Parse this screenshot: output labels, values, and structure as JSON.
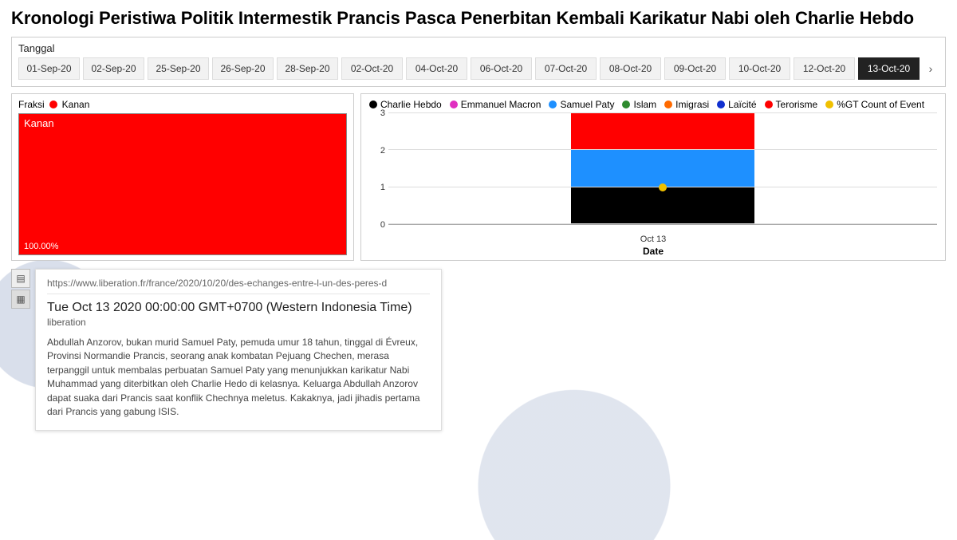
{
  "title": "Kronologi Peristiwa Politik Intermestik Prancis Pasca Penerbitan Kembali Karikatur Nabi oleh Charlie Hebdo",
  "slicer": {
    "label": "Tanggal",
    "dates": [
      "01-Sep-20",
      "02-Sep-20",
      "25-Sep-20",
      "26-Sep-20",
      "28-Sep-20",
      "02-Oct-20",
      "04-Oct-20",
      "06-Oct-20",
      "07-Oct-20",
      "08-Oct-20",
      "09-Oct-20",
      "10-Oct-20",
      "12-Oct-20",
      "13-Oct-20"
    ],
    "selected": "13-Oct-20"
  },
  "fraksi": {
    "title": "Fraksi",
    "legend_label": "Kanan",
    "legend_color": "#ff0000",
    "block_label": "Kanan",
    "pct": "100.00%"
  },
  "chart": {
    "legend": [
      {
        "label": "Charlie Hebdo",
        "color": "#000000"
      },
      {
        "label": "Emmanuel Macron",
        "color": "#e030c0"
      },
      {
        "label": "Samuel Paty",
        "color": "#1e90ff"
      },
      {
        "label": "Islam",
        "color": "#2e8b2e"
      },
      {
        "label": "Imigrasi",
        "color": "#ff6a00"
      },
      {
        "label": "Laïcité",
        "color": "#1030d0"
      },
      {
        "label": "Terorisme",
        "color": "#ff0000"
      },
      {
        "label": "%GT Count of Event",
        "color": "#f0c000"
      }
    ],
    "y_ticks": [
      "0",
      "1",
      "2",
      "3"
    ],
    "x_label": "Oct 13",
    "x_title": "Date"
  },
  "chart_data": {
    "type": "bar",
    "title": "",
    "xlabel": "Date",
    "ylabel": "",
    "ylim": [
      0,
      3
    ],
    "categories": [
      "Oct 13"
    ],
    "series": [
      {
        "name": "Charlie Hebdo",
        "color": "#000000",
        "values": [
          1
        ]
      },
      {
        "name": "Samuel Paty",
        "color": "#1e90ff",
        "values": [
          1
        ]
      },
      {
        "name": "Terorisme",
        "color": "#ff0000",
        "values": [
          1
        ]
      },
      {
        "name": "Emmanuel Macron",
        "color": "#e030c0",
        "values": [
          0
        ]
      },
      {
        "name": "Islam",
        "color": "#2e8b2e",
        "values": [
          0
        ]
      },
      {
        "name": "Imigrasi",
        "color": "#ff6a00",
        "values": [
          0
        ]
      },
      {
        "name": "Laïcité",
        "color": "#1030d0",
        "values": [
          0
        ]
      }
    ],
    "secondary_series": {
      "name": "%GT Count of Event",
      "color": "#f0c000",
      "values": [
        1
      ]
    }
  },
  "card": {
    "url": "https://www.liberation.fr/france/2020/10/20/des-echanges-entre-l-un-des-peres-d",
    "date": "Tue Oct 13 2020 00:00:00 GMT+0700 (Western Indonesia Time)",
    "source": "liberation",
    "body": "Abdullah Anzorov, bukan murid Samuel Paty, pemuda umur 18 tahun, tinggal di Évreux, Provinsi Normandie Prancis, seorang anak kombatan Pejuang Chechen, merasa terpanggil untuk membalas perbuatan Samuel Paty yang menunjukkan karikatur Nabi Muhammad yang diterbitkan oleh Charlie Hedo di kelasnya. Keluarga Abdullah Anzorov dapat suaka dari Prancis saat konflik Chechnya meletus. Kakaknya, jadi jihadis pertama dari Prancis yang gabung ISIS."
  }
}
